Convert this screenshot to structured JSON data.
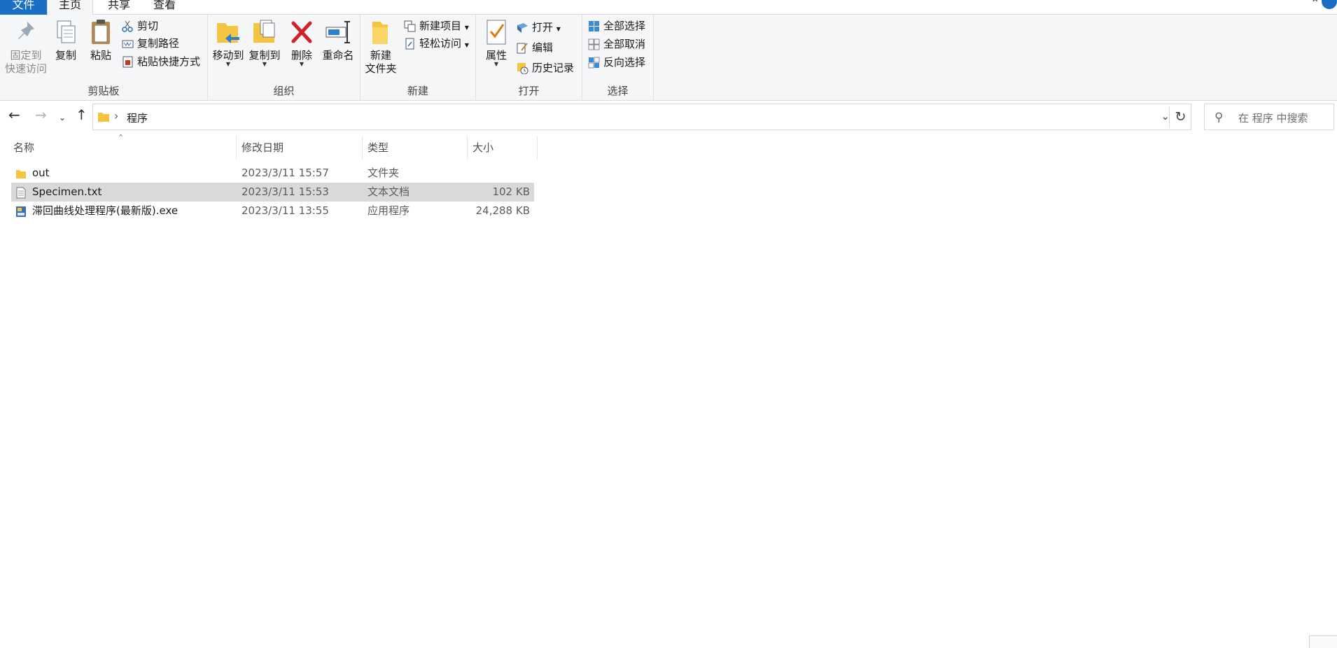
{
  "tabs": {
    "file": "文件",
    "home": "主页",
    "share": "共享",
    "view": "查看"
  },
  "ribbon": {
    "clipboard": {
      "label": "剪贴板",
      "pin_line1": "固定到",
      "pin_line2": "快速访问",
      "copy": "复制",
      "paste": "粘贴",
      "cut": "剪切",
      "copy_path": "复制路径",
      "paste_shortcut": "粘贴快捷方式"
    },
    "organize": {
      "label": "组织",
      "move_to": "移动到",
      "copy_to": "复制到",
      "delete": "删除",
      "rename": "重命名"
    },
    "new": {
      "label": "新建",
      "new_folder_line1": "新建",
      "new_folder_line2": "文件夹",
      "new_item": "新建项目",
      "easy_access": "轻松访问"
    },
    "open": {
      "label": "打开",
      "properties": "属性",
      "open": "打开",
      "edit": "编辑",
      "history": "历史记录"
    },
    "select": {
      "label": "选择",
      "select_all": "全部选择",
      "select_none": "全部取消",
      "invert": "反向选择"
    }
  },
  "address": {
    "crumb": "程序",
    "search_placeholder": "在 程序 中搜索"
  },
  "columns": {
    "name": "名称",
    "date": "修改日期",
    "type": "类型",
    "size": "大小"
  },
  "files": [
    {
      "name": "out",
      "date": "2023/3/11 15:57",
      "type": "文件夹",
      "size": "",
      "icon": "folder-icon"
    },
    {
      "name": "Specimen.txt",
      "date": "2023/3/11 15:53",
      "type": "文本文档",
      "size": "102 KB",
      "icon": "text-file-icon"
    },
    {
      "name": "滞回曲线处理程序(最新版).exe",
      "date": "2023/3/11 13:55",
      "type": "应用程序",
      "size": "24,288 KB",
      "icon": "exe-file-icon"
    }
  ],
  "colors": {
    "accent": "#1a6fc4",
    "selection": "#d9d9d9",
    "ribbon_bg": "#f5f6f7"
  }
}
